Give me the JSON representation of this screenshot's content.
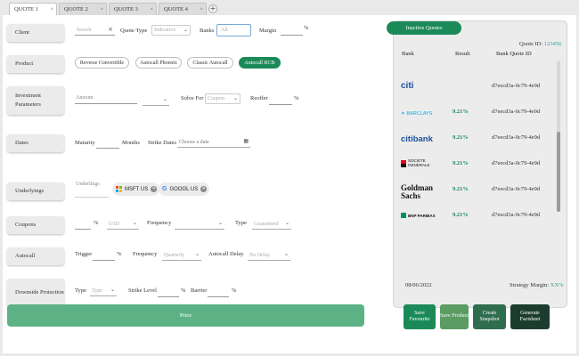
{
  "tabs": [
    {
      "label": "QUOTE 1",
      "active": true
    },
    {
      "label": "QUOTE 2",
      "active": false
    },
    {
      "label": "QUOTE 3",
      "active": false
    },
    {
      "label": "QUOTE 4",
      "active": false
    }
  ],
  "tab_close": "×",
  "tab_add": "+",
  "labels": {
    "client": "Client",
    "product": "Product",
    "investment": "Investment Parameters",
    "dates": "Dates",
    "underlyings": "Underlyings",
    "coupons": "Coupons",
    "autocall": "Autocall",
    "downside": "Downside Protection"
  },
  "client_row": {
    "search_placeholder": "Search",
    "search_clear": "×",
    "quote_type_label": "Quote Type",
    "quote_type_value": "Indicative",
    "banks_label": "Banks",
    "banks_value": "All",
    "margin_label": "Margin",
    "margin_unit": "%"
  },
  "products": [
    {
      "label": "Reverse Convertible",
      "selected": false
    },
    {
      "label": "Autocall Phoenix",
      "selected": false
    },
    {
      "label": "Classic Autocall",
      "selected": false
    },
    {
      "label": "Autocall RCB",
      "selected": true
    }
  ],
  "investment_row": {
    "amount_placeholder": "Amount",
    "solve_for_label": "Solve For",
    "solve_for_value": "Coupon",
    "reoffer_label": "Reoffer",
    "reoffer_unit": "%"
  },
  "dates_row": {
    "maturity_label": "Maturity",
    "maturity_unit": "Months",
    "strike_dates_label": "Strike Dates",
    "strike_dates_placeholder": "Choose a date"
  },
  "underlyings_row": {
    "placeholder": "Underlings",
    "chips": [
      {
        "label": "MSFT US",
        "icon": "microsoft-icon"
      },
      {
        "label": "GOOGL US",
        "icon": "google-icon"
      }
    ]
  },
  "coupons_row": {
    "pct_unit": "%",
    "currency_value": "USD",
    "frequency_label": "Frequency",
    "type_label": "Type",
    "type_value": "Guaranteed"
  },
  "autocall_row": {
    "trigger_label": "Trigger",
    "trigger_unit": "%",
    "frequency_label": "Frequency",
    "frequency_value": "Quarterly",
    "delay_label": "Autocall Delay",
    "delay_value": "No Delay"
  },
  "downside_row": {
    "type_label": "Type",
    "type_value": "Type",
    "strike_label": "Strike Level",
    "strike_unit": "%",
    "barrier_label": "Barrier",
    "barrier_unit": "%"
  },
  "price_button": "Price",
  "right_panel": {
    "inactive_quotes": "Inactive Quotes",
    "quote_id_label": "Quote ID:",
    "quote_id_value": "123456",
    "col_bank": "Bank",
    "col_result": "Result",
    "col_bank_quote_id": "Bank Quote ID",
    "rows": [
      {
        "bank": "citi",
        "result": "",
        "bank_quote_id": "d7eecd3a-0c79-4e9d"
      },
      {
        "bank": "BARCLAYS",
        "result": "9.21%",
        "bank_quote_id": "d7eecd3a-0c79-4e9d"
      },
      {
        "bank": "citibank",
        "result": "9.21%",
        "bank_quote_id": "d7eecd3a-0c79-4e9d"
      },
      {
        "bank": "SOCIETE GENERALE",
        "result": "9.21%",
        "bank_quote_id": "d7eecd3a-0c79-4e9d"
      },
      {
        "bank": "Goldman Sachs",
        "result": "9.21%",
        "bank_quote_id": "d7eecd3a-0c79-4e9d"
      },
      {
        "bank": "BNP PARIBAS",
        "result": "9.21%",
        "bank_quote_id": "d7eecd3a-0c79-4e9d"
      }
    ],
    "date": "08/06/2022",
    "strategy_margin_label": "Strategy Margin:",
    "strategy_margin_value": "XX%"
  },
  "action_buttons": [
    {
      "label": "Save Favourite",
      "color": "#1b8a58"
    },
    {
      "label": "Save Product",
      "color": "#5a9c62"
    },
    {
      "label": "Create Snapshot",
      "color": "#2f6d4f"
    },
    {
      "label": "Generate Factsheet",
      "color": "#1c3d2e"
    }
  ],
  "colors": {
    "accent": "#1b8a58",
    "price_button": "#5cb285",
    "result_text": "#1b8a58",
    "quote_id": "#2a9d8f"
  }
}
